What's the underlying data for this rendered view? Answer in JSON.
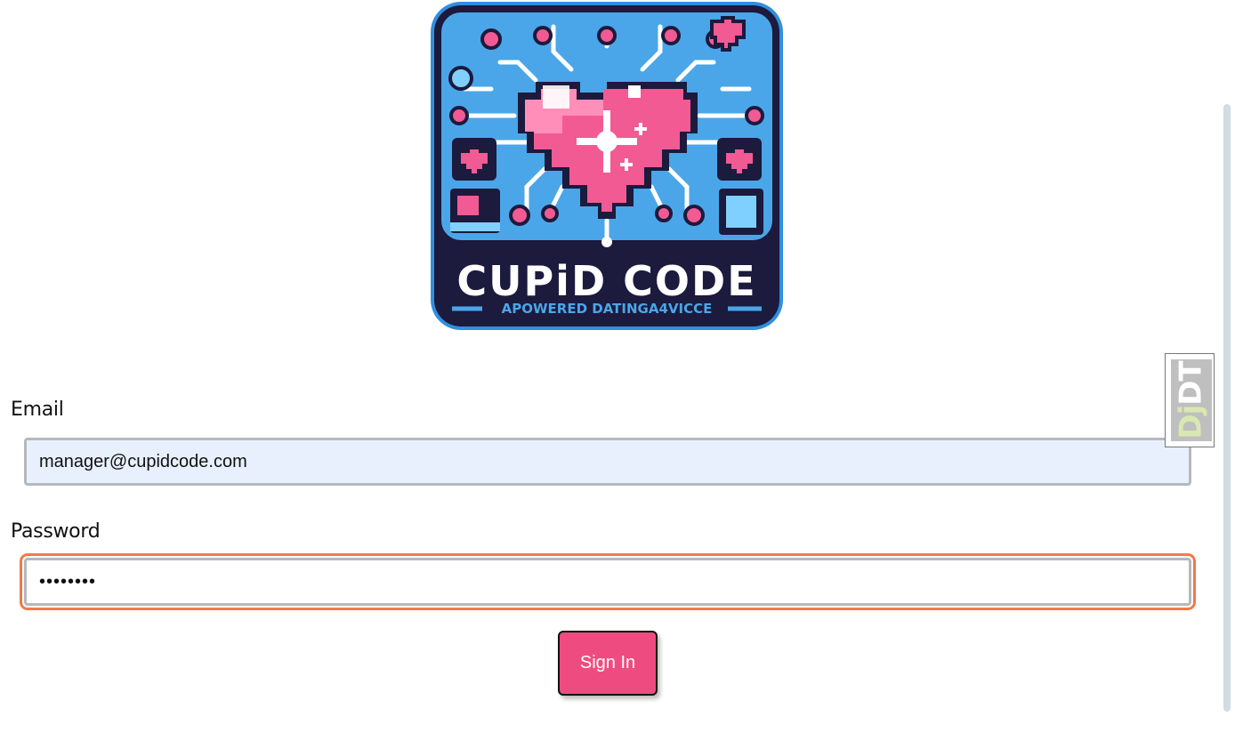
{
  "logo": {
    "title": "CUPiD CODE",
    "tagline": "APOWERED DATINGA4VICCE",
    "colors": {
      "frame": "#1c1a3d",
      "panel": "#4aa6e8",
      "heart": "#f25a93",
      "accent": "#ffffff"
    }
  },
  "form": {
    "email_label": "Email",
    "email_value": "manager@cupidcode.com",
    "password_label": "Password",
    "password_value": "••••••••",
    "sign_in_label": "Sign In"
  },
  "debug_toolbar": {
    "handle_dj": "Dj",
    "handle_dt": "DT"
  },
  "colors": {
    "button": "#ee4c80",
    "focus_ring": "#f07a48",
    "autofill_bg": "#e8f0fe"
  }
}
